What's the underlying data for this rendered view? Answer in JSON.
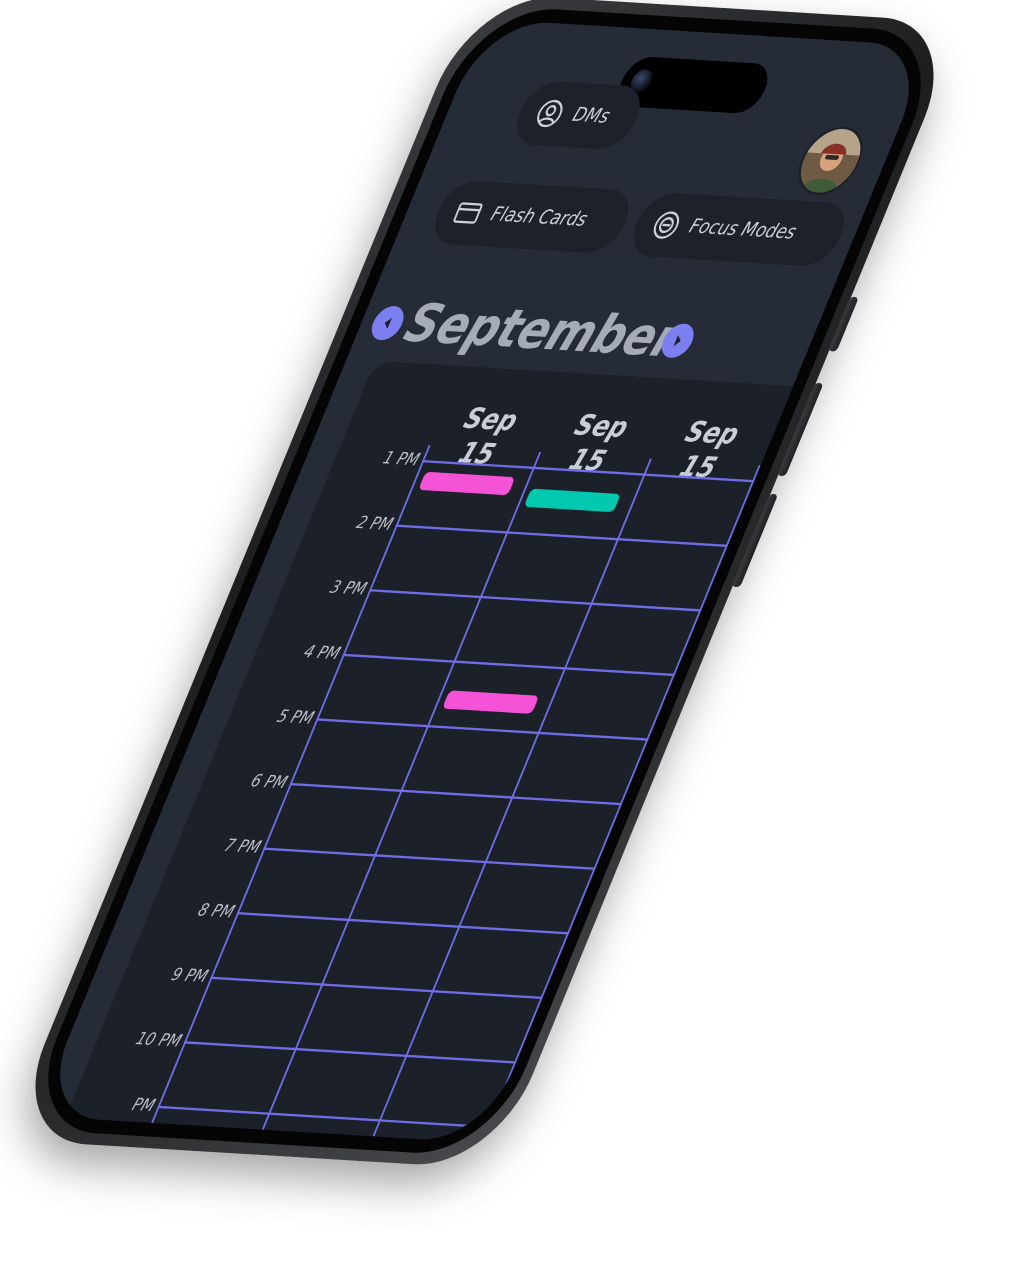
{
  "header": {
    "pills": {
      "dms": "DMs",
      "flash_cards": "Flash Cards",
      "focus_modes": "Focus Modes"
    },
    "avatar_icon": "user-avatar-icon"
  },
  "calendar": {
    "month": "September",
    "prev_icon": "chevron-left-icon",
    "next_icon": "chevron-right-icon",
    "days": [
      {
        "month": "Sep",
        "day": "15"
      },
      {
        "month": "Sep",
        "day": "15"
      },
      {
        "month": "Sep",
        "day": "15"
      }
    ],
    "hours": [
      "1 PM",
      "2 PM",
      "3 PM",
      "4 PM",
      "5 PM",
      "6 PM",
      "7 PM",
      "8 PM",
      "9 PM",
      "10 PM",
      "PM"
    ],
    "events": [
      {
        "day_index": 0,
        "start": "1 PM",
        "color": "#f453d8"
      },
      {
        "day_index": 1,
        "start": "1 PM",
        "color": "#00c9b0"
      },
      {
        "day_index": 1,
        "start": "4 PM",
        "color": "#f453d8"
      }
    ]
  },
  "colors": {
    "screen_bg": "#262c37",
    "panel_bg": "#1c2029",
    "grid_line": "#6e6ee6",
    "accent": "#7b7ff0",
    "pink_event": "#f453d8",
    "teal_event": "#00c9b0"
  }
}
